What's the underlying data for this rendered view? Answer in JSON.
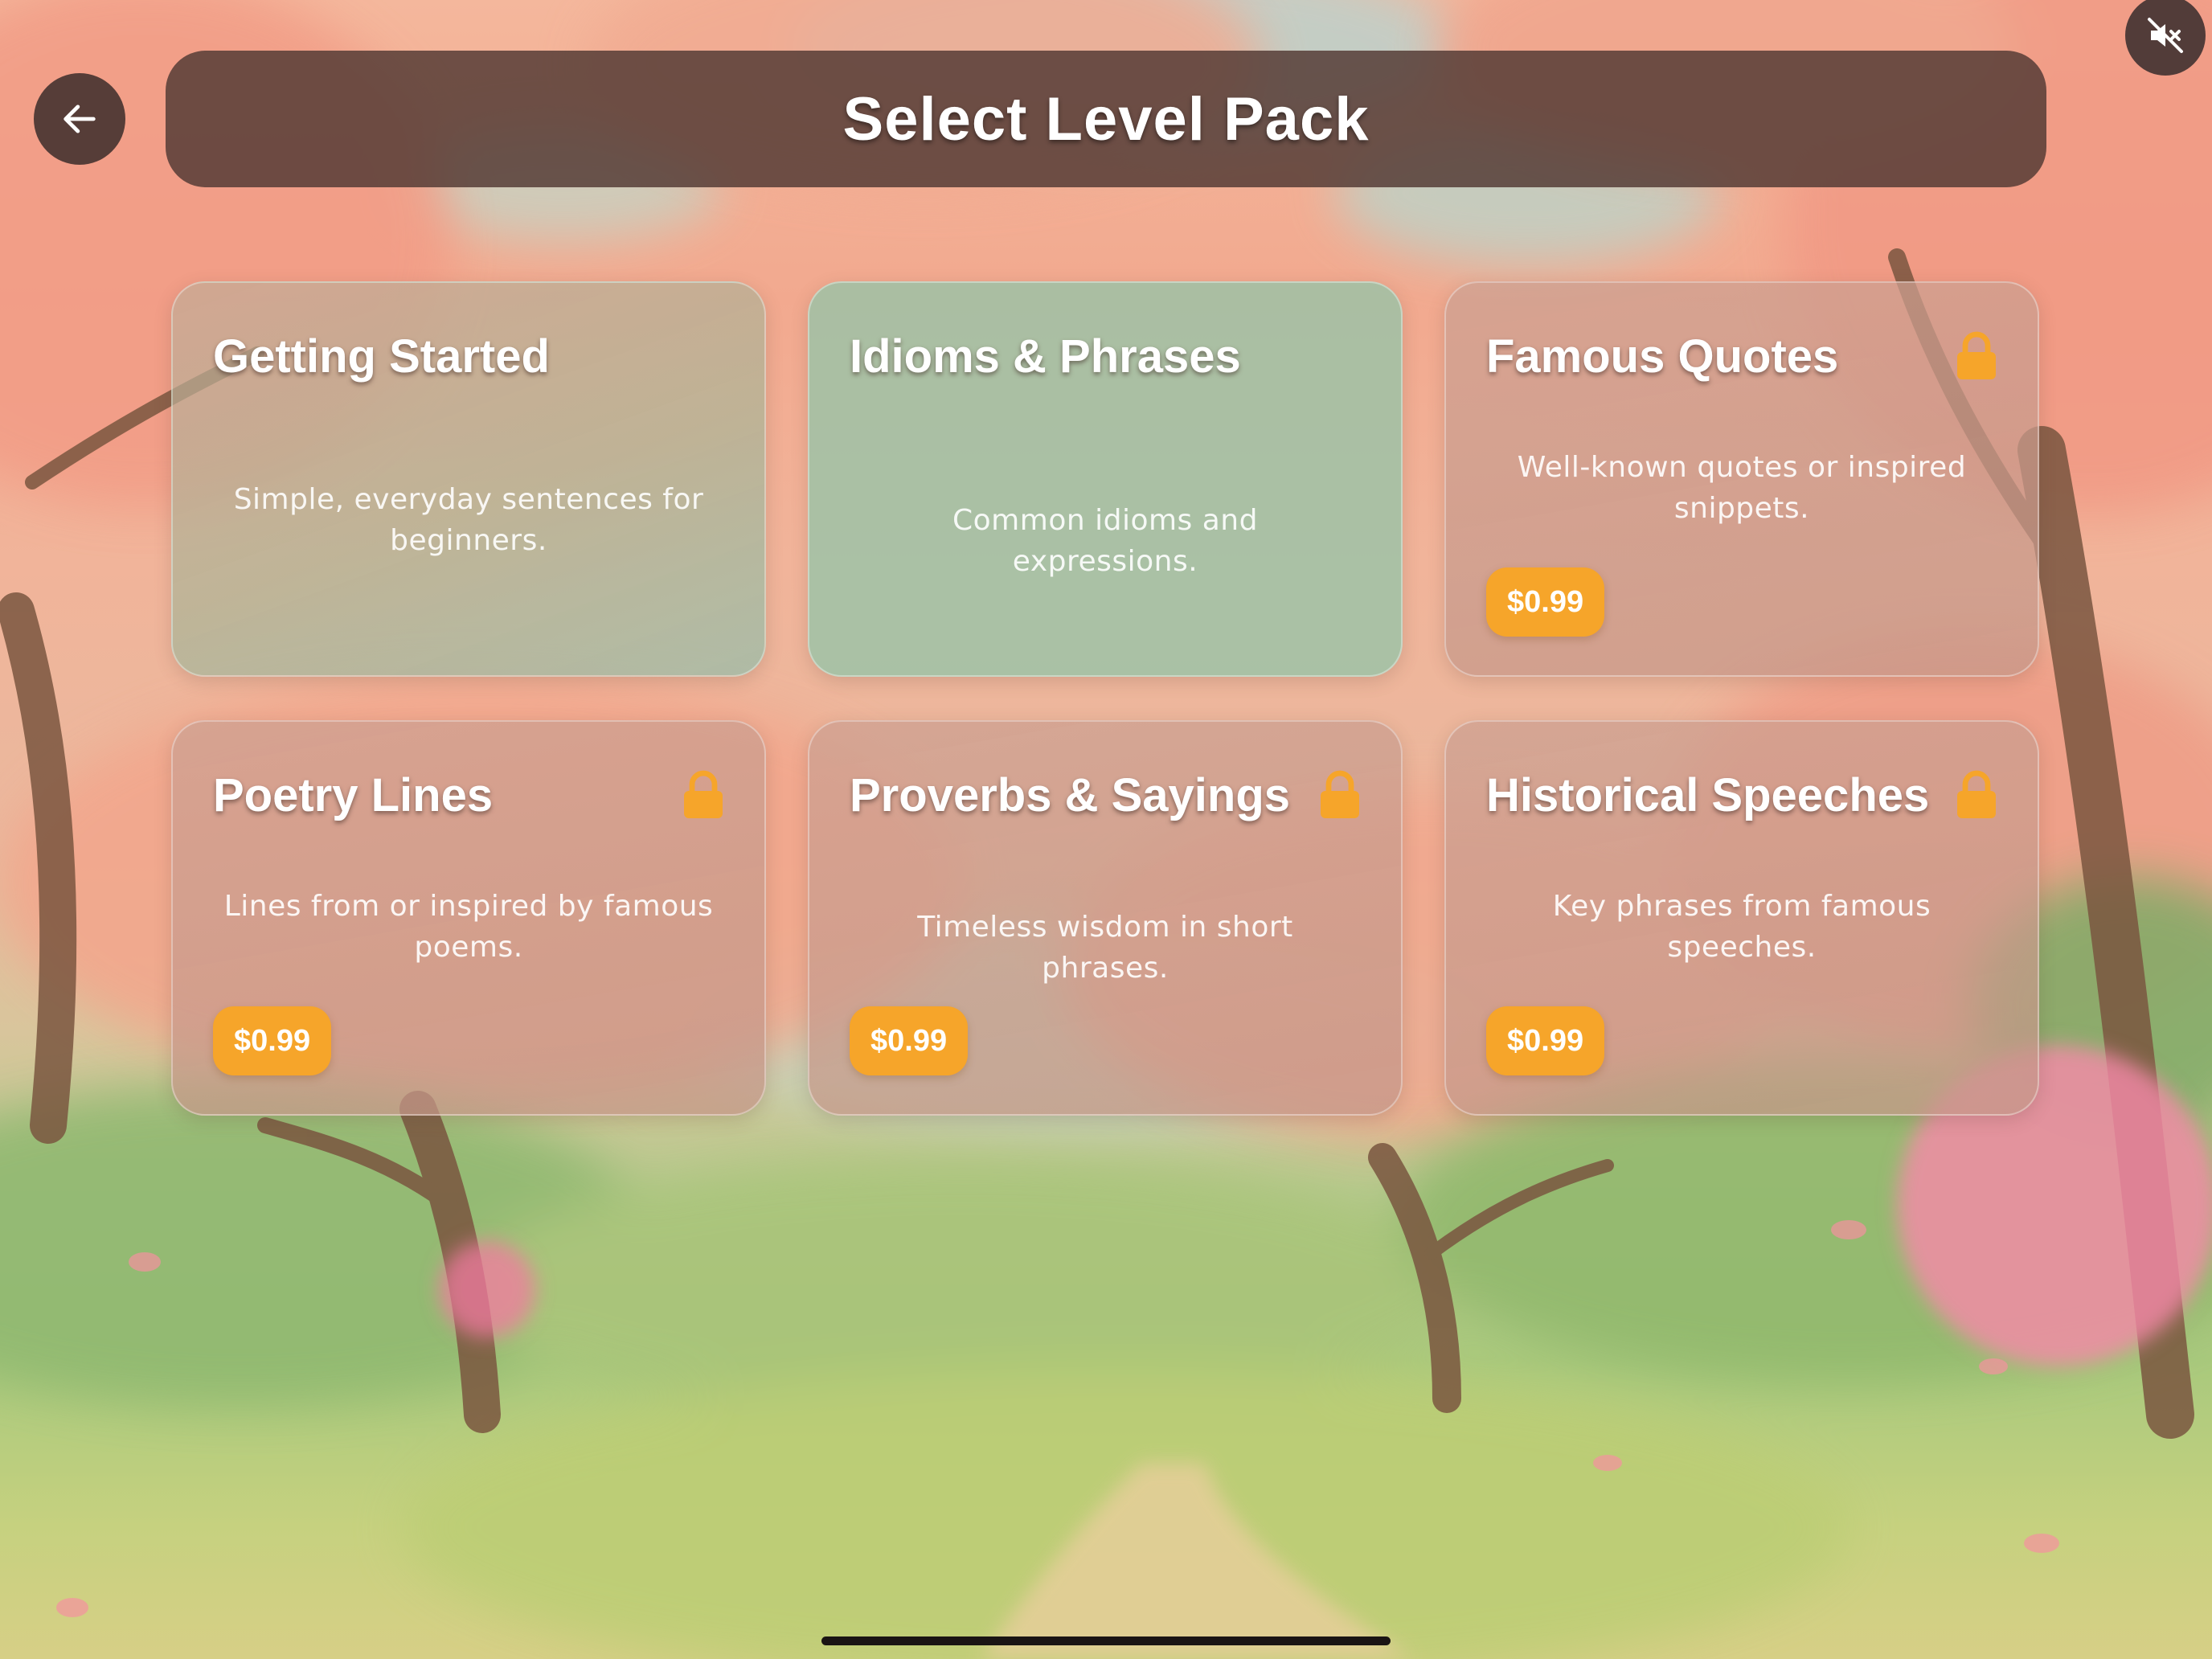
{
  "header": {
    "title": "Select Level Pack",
    "back_icon": "arrow-left-icon",
    "mute_icon": "speaker-muted-icon"
  },
  "packs": [
    {
      "title": "Getting Started",
      "description": "Simple, everyday sentences for beginners.",
      "locked": false,
      "price": ""
    },
    {
      "title": "Idioms & Phrases",
      "description": "Common idioms and expressions.",
      "locked": false,
      "price": ""
    },
    {
      "title": "Famous Quotes",
      "description": "Well-known quotes or inspired snippets.",
      "locked": true,
      "price": "$0.99"
    },
    {
      "title": "Poetry Lines",
      "description": "Lines from or inspired by famous poems.",
      "locked": true,
      "price": "$0.99"
    },
    {
      "title": "Proverbs & Sayings",
      "description": "Timeless wisdom in short phrases.",
      "locked": true,
      "price": "$0.99"
    },
    {
      "title": "Historical Speeches",
      "description": "Key phrases from famous speeches.",
      "locked": true,
      "price": "$0.99"
    }
  ],
  "colors": {
    "price_badge": "#f6a52a",
    "lock_icon": "#f6a52a",
    "header_bg": "#543a34"
  }
}
